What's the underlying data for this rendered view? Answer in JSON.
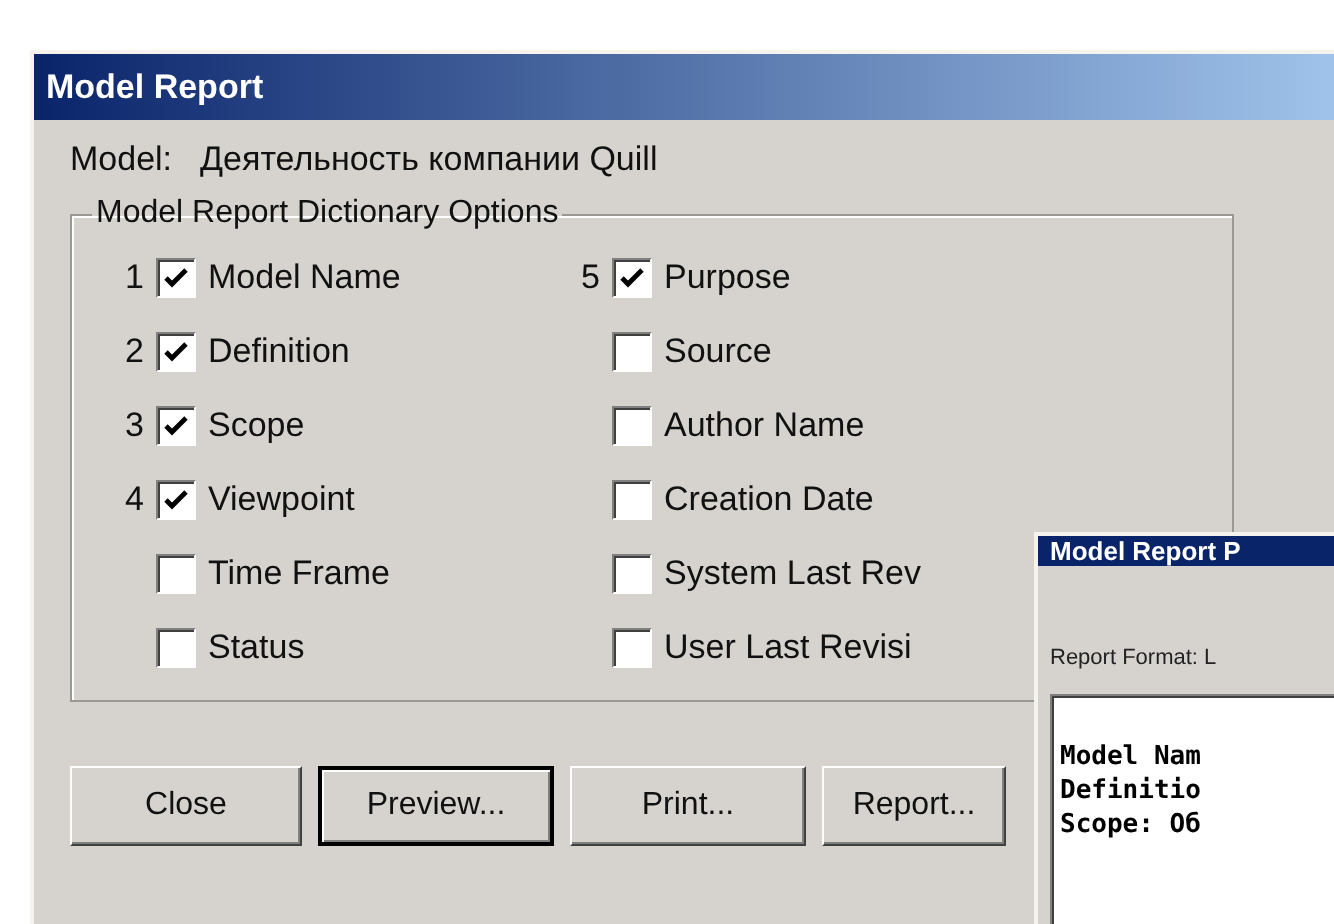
{
  "main_window": {
    "title": "Model Report",
    "model_label": "Model:",
    "model_value": "Деятельность компании Quill",
    "group_title": "Model Report Dictionary Options",
    "options_left": [
      {
        "number": "1",
        "label": "Model Name",
        "checked": true
      },
      {
        "number": "2",
        "label": "Definition",
        "checked": true
      },
      {
        "number": "3",
        "label": "Scope",
        "checked": true
      },
      {
        "number": "4",
        "label": "Viewpoint",
        "checked": true
      },
      {
        "label": "Time Frame",
        "checked": false
      },
      {
        "label": "Status",
        "checked": false
      }
    ],
    "options_right": [
      {
        "number": "5",
        "label": "Purpose",
        "checked": true
      },
      {
        "label": "Source",
        "checked": false
      },
      {
        "label": "Author Name",
        "checked": false
      },
      {
        "label": "Creation Date",
        "checked": false
      },
      {
        "label": "System Last Rev",
        "checked": false
      },
      {
        "label": "User Last Revisi",
        "checked": false
      }
    ],
    "buttons": [
      {
        "label": "Close",
        "default": false
      },
      {
        "label": "Preview...",
        "default": true
      },
      {
        "label": "Print...",
        "default": false
      },
      {
        "label": "Report...",
        "default": false
      }
    ]
  },
  "preview_window": {
    "title": "Model Report P",
    "format_label": "Report Format: L",
    "lines": [
      "Model Nam",
      "Definitio",
      "Scope: Об"
    ]
  }
}
